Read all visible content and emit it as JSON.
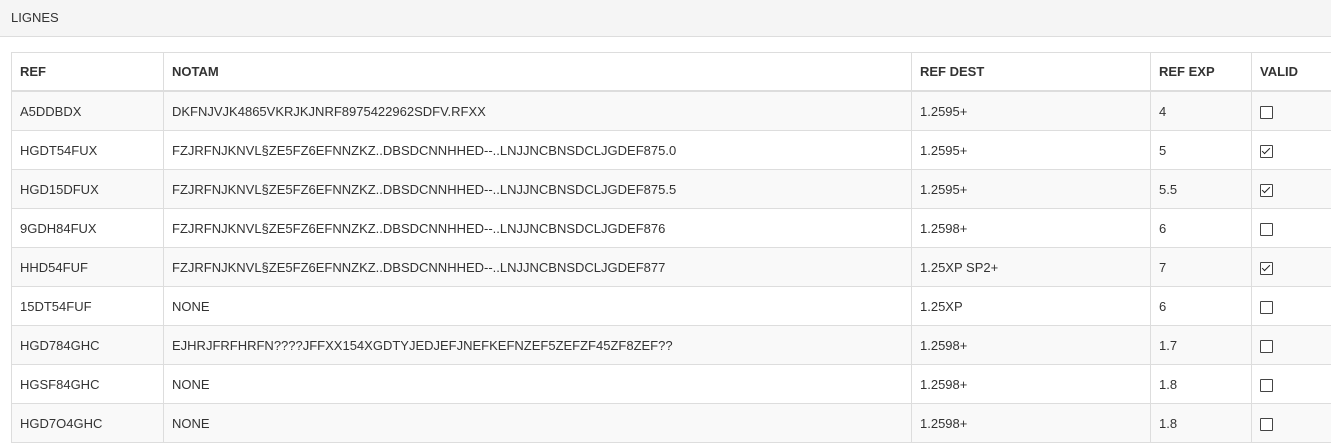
{
  "panel": {
    "title": "LIGNES"
  },
  "table": {
    "headers": {
      "ref": "REF",
      "notam": "NOTAM",
      "ref_dest": "REF DEST",
      "ref_exp": "REF EXP",
      "valid": "VALID"
    },
    "rows": [
      {
        "ref": "A5DDBDX",
        "notam": "DKFNJVJK4865VKRJKJNRF8975422962SDFV.RFXX",
        "ref_dest": "1.2595+",
        "ref_exp": "4",
        "valid": false
      },
      {
        "ref": "HGDT54FUX",
        "notam": "FZJRFNJKNVL§ZE5FZ6EFNNZKZ..DBSDCNNHHED--..LNJJNCBNSDCLJGDEF875.0",
        "ref_dest": "1.2595+",
        "ref_exp": "5",
        "valid": true
      },
      {
        "ref": "HGD15DFUX",
        "notam": "FZJRFNJKNVL§ZE5FZ6EFNNZKZ..DBSDCNNHHED--..LNJJNCBNSDCLJGDEF875.5",
        "ref_dest": "1.2595+",
        "ref_exp": "5.5",
        "valid": true
      },
      {
        "ref": "9GDH84FUX",
        "notam": "FZJRFNJKNVL§ZE5FZ6EFNNZKZ..DBSDCNNHHED--..LNJJNCBNSDCLJGDEF876",
        "ref_dest": "1.2598+",
        "ref_exp": "6",
        "valid": false
      },
      {
        "ref": "HHD54FUF",
        "notam": "FZJRFNJKNVL§ZE5FZ6EFNNZKZ..DBSDCNNHHED--..LNJJNCBNSDCLJGDEF877",
        "ref_dest": "1.25XP SP2+",
        "ref_exp": "7",
        "valid": true
      },
      {
        "ref": "15DT54FUF",
        "notam": "NONE",
        "ref_dest": "1.25XP",
        "ref_exp": "6",
        "valid": false
      },
      {
        "ref": "HGD784GHC",
        "notam": "EJHRJFRFHRFN????JFFXX154XGDTYJEDJEFJNEFKEFNZEF5ZEFZF45ZF8ZEF??",
        "ref_dest": "1.2598+",
        "ref_exp": "1.7",
        "valid": false
      },
      {
        "ref": "HGSF84GHC",
        "notam": "NONE",
        "ref_dest": "1.2598+",
        "ref_exp": "1.8",
        "valid": false
      },
      {
        "ref": "HGD7O4GHC",
        "notam": "NONE",
        "ref_dest": "1.2598+",
        "ref_exp": "1.8",
        "valid": false
      }
    ]
  }
}
